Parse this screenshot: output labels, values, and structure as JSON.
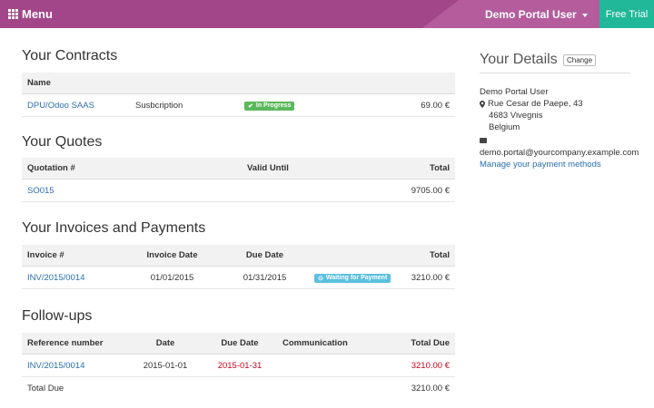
{
  "header": {
    "menu_label": "Menu",
    "user_label": "Demo Portal User",
    "trial_label": "Free Trial"
  },
  "contracts": {
    "title": "Your Contracts",
    "columns": [
      "Name"
    ],
    "rows": [
      {
        "name": "DPU/Odoo SAAS",
        "type": "Susbcription",
        "status": "In Progress",
        "amount": "69.00 €"
      }
    ]
  },
  "quotes": {
    "title": "Your Quotes",
    "columns": [
      "Quotation #",
      "Valid Until",
      "Total"
    ],
    "rows": [
      {
        "number": "SO015",
        "valid_until": "",
        "total": "9705.00 €"
      }
    ]
  },
  "invoices": {
    "title": "Your Invoices and Payments",
    "columns": [
      "Invoice #",
      "Invoice Date",
      "Due Date",
      "Total"
    ],
    "rows": [
      {
        "number": "INV/2015/0014",
        "invoice_date": "01/01/2015",
        "due_date": "01/31/2015",
        "status": "Waiting for Payment",
        "total": "3210.00 €"
      }
    ]
  },
  "followups": {
    "title": "Follow-ups",
    "columns": [
      "Reference number",
      "Date",
      "Due Date",
      "Communication",
      "Total Due"
    ],
    "rows": [
      {
        "reference": "INV/2015/0014",
        "date": "2015-01-01",
        "due_date": "2015-01-31",
        "communication": "",
        "total_due": "3210.00 €"
      }
    ],
    "total_label": "Total Due",
    "total_value": "3210.00 €"
  },
  "details": {
    "title": "Your Details",
    "change_label": "Change",
    "name": "Demo Portal User",
    "street": "Rue Cesar de Paepe, 43",
    "city": "4683 Vivegnis",
    "country": "Belgium",
    "email": "demo.portal@yourcompany.example.com",
    "payment_link": "Manage your payment methods"
  },
  "colors": {
    "header": "#a24689",
    "trial": "#21b799",
    "link": "#2a6fb0",
    "overdue": "#d0021b",
    "progress_badge": "#5cb85c",
    "waiting_badge": "#5bc0de"
  }
}
